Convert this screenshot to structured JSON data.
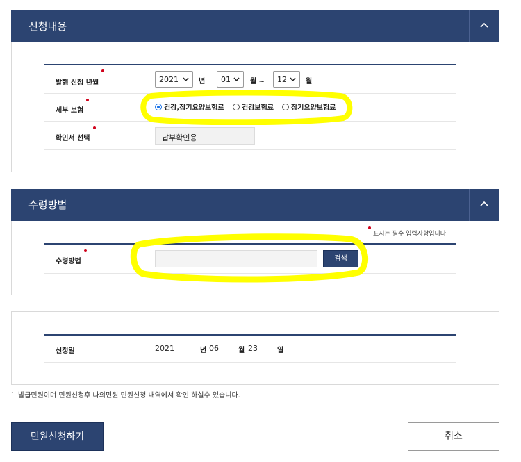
{
  "section1": {
    "title": "신청내용",
    "rows": {
      "period_label": "발행 신청 년월",
      "year_value": "2021",
      "year_unit": "년",
      "month_from": "01",
      "month_sep": "월 ~",
      "month_to": "12",
      "month_unit": "월",
      "insurance_label": "세부 보험",
      "insurance_options": [
        "건강,장기요양보험료",
        "건강보험료",
        "장기요양보험료"
      ],
      "insurance_selected": 0,
      "cert_label": "확인서 선택",
      "cert_value": "납부확인용"
    }
  },
  "section2": {
    "title": "수령방법",
    "required_note": "표시는 필수 입력사항입니다.",
    "method_label": "수령방법",
    "method_value": "",
    "search_button": "검색"
  },
  "section3": {
    "date_label": "신청일",
    "year": "2021",
    "year_unit": "년",
    "month": "06",
    "month_unit": "월",
    "day": "23",
    "day_unit": "일"
  },
  "footer_note": "발급민원이며 민원신청후 나의민원 민원신청 내역에서 확인 하실수 있습니다.",
  "buttons": {
    "submit": "민원신청하기",
    "cancel": "취소"
  },
  "colors": {
    "header_navy": "#2c4471",
    "required_red": "#d0021b",
    "highlight_yellow": "#ffff00",
    "radio_blue": "#1a73e8"
  },
  "icons": {
    "collapse": "chevron-up-icon",
    "dropdown": "chevron-down-icon"
  }
}
